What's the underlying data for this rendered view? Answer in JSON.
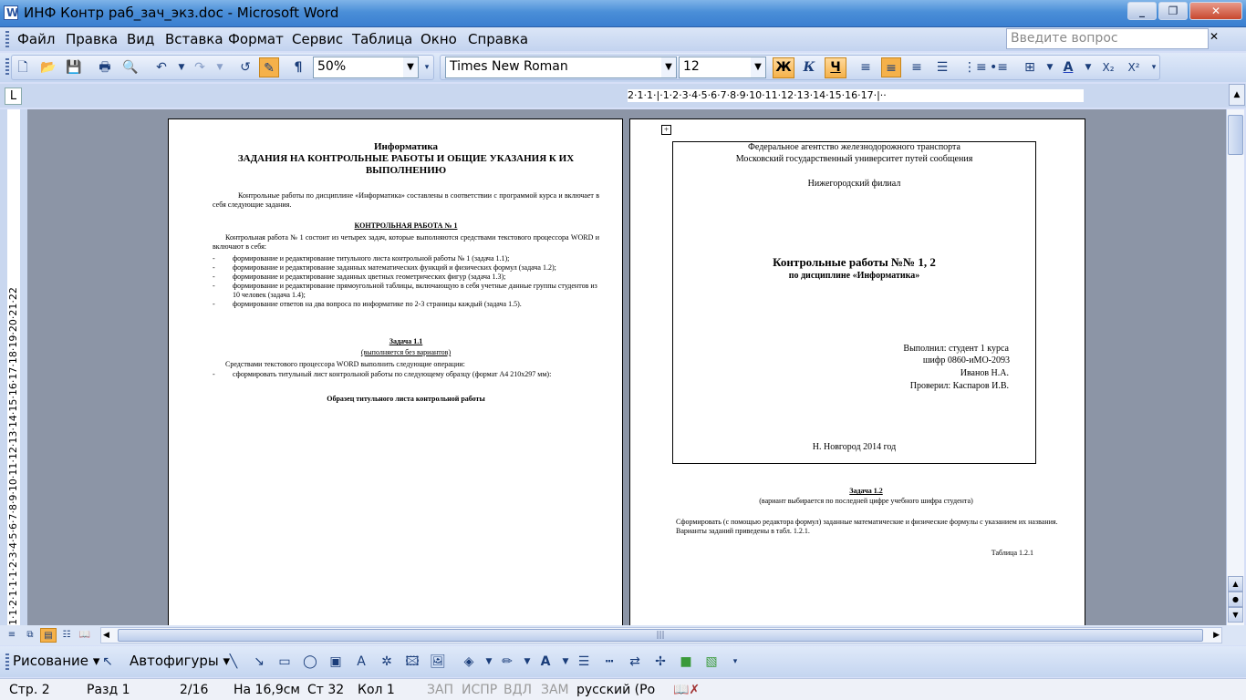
{
  "window": {
    "title": "ИНФ Контр раб_зач_экз.doc - Microsoft Word",
    "minimize": "_",
    "maximize": "❐",
    "close": "✕"
  },
  "menu": {
    "items": [
      "Файл",
      "Правка",
      "Вид",
      "Вставка",
      "Формат",
      "Сервис",
      "Таблица",
      "Окно",
      "Справка"
    ],
    "ask_placeholder": "Введите вопрос",
    "ask_close": "✕"
  },
  "toolbar": {
    "zoom": "50%",
    "font_name": "Times New Roman",
    "font_size": "12",
    "bold": "Ж",
    "italic": "К",
    "underline": "Ч",
    "paragraph_mark": "¶",
    "subscript": "X₂",
    "superscript": "X²"
  },
  "ruler": {
    "tab_stop": "L",
    "horizontal": "2·1·1·|·1·2·3·4·5·6·7·8·9·10·11·12·13·14·15·16·17·|··",
    "vertical": "1·1·2·1·1·1·2·3·4·5·6·7·8·9·10·11·12·13·14·15·16·17·18·19·20·21·22"
  },
  "page1": {
    "subject": "Информатика",
    "heading": "ЗАДАНИЯ НА КОНТРОЛЬНЫЕ РАБОТЫ И  ОБЩИЕ УКАЗАНИЯ К ИХ ВЫПОЛНЕНИЮ",
    "intro": "Контрольные работы по дисциплине «Информатика» составлены в соответствии с программой курса и включает в себя следующие задания.",
    "kr1_title": "КОНТРОЛЬНАЯ РАБОТА № 1",
    "kr1_intro": "Контрольная работа № 1 состоит из четырех задач, которые выполняются средствами текстового процессора  WORD и включают в себя:",
    "tasks": [
      "формирование и редактирование титульного листа контрольной работы № 1 (задача 1.1);",
      "формирование и редактирование заданных математических функций и физических формул (задача 1.2);",
      "формирование и редактирование заданных цветных геометрических фигур (задача 1.3);",
      "формирование и редактирование прямоугольной таблицы, включающую в себя учетные данные группы студентов из 10 человек (задача 1.4);",
      "формирование ответов на два вопроса по информатике по 2-3 страницы каждый (задача 1.5)."
    ],
    "task11_title": "Задача 1.1",
    "task11_sub": "(выполняется без вариантов)",
    "task11_text": "Средствами текстового процессора WORD выполнить следующие операции:",
    "task11_item": "сформировать титульный лист контрольной работы по следующему образцу (формат А4 210х297 мм):",
    "sample_title": "Образец титульного листа контрольной работы"
  },
  "page2": {
    "agency": "Федеральное агентство железнодорожного транспорта",
    "university": "Московский государственный университет путей сообщения",
    "branch": "Нижегородский филиал",
    "works_title": "Контрольные работы №№ 1, 2",
    "discipline": "по дисциплине «Информатика»",
    "done_by": "Выполнил: студент 1 курса",
    "cipher": "шифр 0860-иМО-2093",
    "student": "Иванов Н.А.",
    "checked": "Проверил: Каспаров И.В.",
    "city_year": "Н. Новгород 2014 год",
    "task12_title": "Задача 1.2",
    "task12_sub": "(вариант выбирается по последней цифре учебного шифра студента)",
    "task12_text": "Сформировать (с помощью редактора формул) заданные математические и физические формулы с указанием их названия. Варианты заданий приведены в табл. 1.2.1.",
    "table_caption": "Таблица 1.2.1"
  },
  "drawbar": {
    "drawing": "Рисование",
    "autoshapes": "Автофигуры"
  },
  "status": {
    "page": "Стр. 2",
    "section": "Разд 1",
    "pages": "2/16",
    "at": "На 16,9см",
    "line": "Ст 32",
    "col": "Кол 1",
    "rec": "ЗАП",
    "trk": "ИСПР",
    "ext": "ВДЛ",
    "ovr": "ЗАМ",
    "lang": "русский (Ро"
  }
}
